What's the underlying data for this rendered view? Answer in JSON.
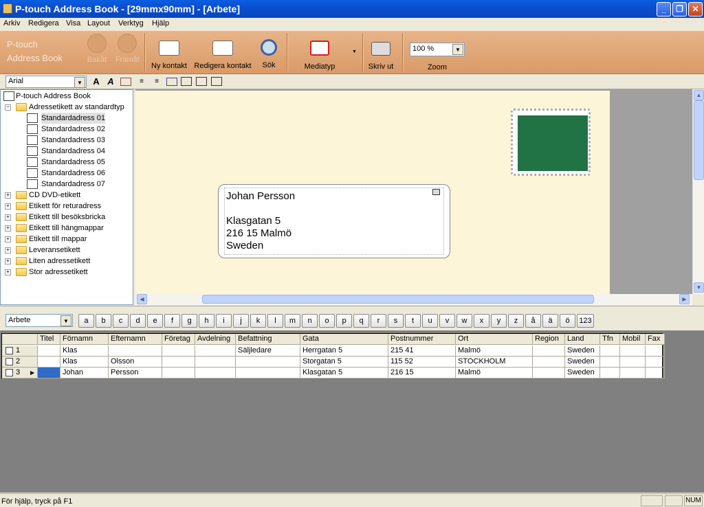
{
  "window": {
    "title": "P-touch Address Book - [29mmx90mm] - [Arbete]",
    "minimize": "_",
    "restore": "❐",
    "close": "✕"
  },
  "menu": [
    "Arkiv",
    "Redigera",
    "Visa",
    "Layout",
    "Verktyg",
    "Hjälp"
  ],
  "logo": {
    "line1": "P-touch",
    "line2": "Address Book"
  },
  "toolbar": {
    "back": "Bakåt",
    "forward": "Framåt",
    "new_contact": "Ny kontakt",
    "edit_contact": "Redigera kontakt",
    "search": "Sök",
    "media_type": "Mediatyp",
    "print": "Skriv ut",
    "zoom": "Zoom",
    "zoom_value": "100 %",
    "back_icon": "back-arrow-icon",
    "forward_icon": "forward-arrow-icon"
  },
  "format": {
    "font": "Arial"
  },
  "tree": {
    "root": "P-touch Address Book",
    "expanded_folder": "Adressetikett av standardtyp",
    "labels": [
      "Standardadress 01",
      "Standardadress 02",
      "Standardadress 03",
      "Standardadress 04",
      "Standardadress 05",
      "Standardadress 06",
      "Standardadress 07"
    ],
    "folders": [
      "CD DVD-etikett",
      "Etikett för returadress",
      "Etikett till besöksbricka",
      "Etikett till hängmappar",
      "Etikett till mappar",
      "Leveransetikett",
      "Liten adressetikett",
      "Stor adressetikett"
    ]
  },
  "address_label": {
    "line1": "Johan Persson",
    "line2": "Klasgatan 5",
    "line3": "216 15 Malmö",
    "line4": "Sweden"
  },
  "group": {
    "selected": "Arbete"
  },
  "alphabet": [
    "a",
    "b",
    "c",
    "d",
    "e",
    "f",
    "g",
    "h",
    "i",
    "j",
    "k",
    "l",
    "m",
    "n",
    "o",
    "p",
    "q",
    "r",
    "s",
    "t",
    "u",
    "v",
    "w",
    "x",
    "y",
    "z",
    "å",
    "ä",
    "ö",
    "123"
  ],
  "table": {
    "columns": [
      "Titel",
      "Förnamn",
      "Efternamn",
      "Företag",
      "Avdelning",
      "Befattning",
      "Gata",
      "Postnummer",
      "Ort",
      "Region",
      "Land",
      "Tfn",
      "Mobil",
      "Fax"
    ],
    "rows": [
      {
        "num": "1",
        "cells": [
          "",
          "Klas",
          "",
          "",
          "",
          "Säljledare",
          "Herrgatan 5",
          "215 41",
          "Malmö",
          "",
          "Sweden",
          "",
          "",
          ""
        ]
      },
      {
        "num": "2",
        "cells": [
          "",
          "Klas",
          "Olsson",
          "",
          "",
          "",
          "Storgatan 5",
          "115 52",
          "STOCKHOLM",
          "",
          "Sweden",
          "",
          "",
          ""
        ]
      },
      {
        "num": "3",
        "cells": [
          "",
          "Johan",
          "Persson",
          "",
          "",
          "",
          "Klasgatan 5",
          "216 15",
          "Malmö",
          "",
          "Sweden",
          "",
          "",
          ""
        ]
      }
    ]
  },
  "status": {
    "text": "För hjälp, tryck på F1",
    "num": "NUM"
  }
}
